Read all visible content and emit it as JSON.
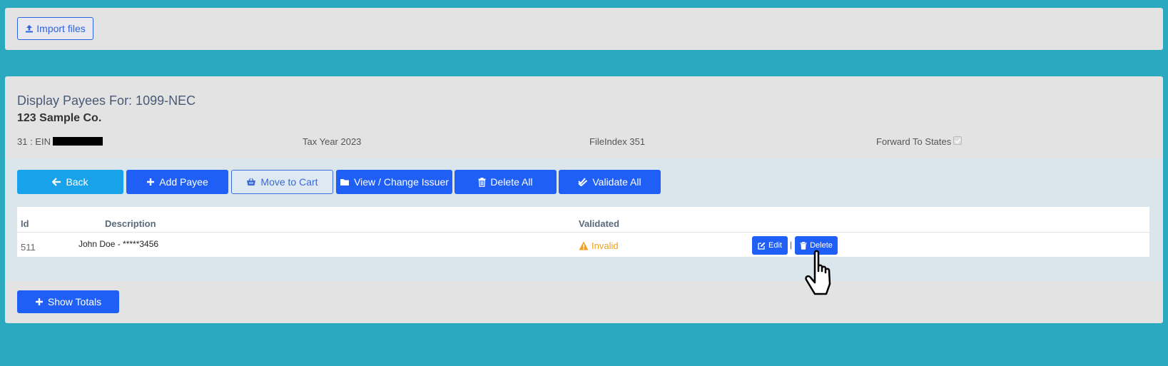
{
  "top": {
    "import_label": "Import files"
  },
  "header": {
    "title": "Display Payees For: 1099-NEC",
    "company": "123 Sample Co.",
    "ein_label": "31 : EIN",
    "tax_year": "Tax Year 2023",
    "file_index": "FileIndex 351",
    "forward_label": "Forward To States"
  },
  "toolbar": {
    "back": "Back",
    "add_payee": "Add Payee",
    "move_to_cart": "Move to Cart",
    "view_change_issuer": "View / Change Issuer",
    "delete_all": "Delete All",
    "validate_all": "Validate All"
  },
  "table": {
    "columns": {
      "id": "Id",
      "description": "Description",
      "validated": "Validated"
    },
    "rows": [
      {
        "id": "511",
        "description": "John Doe - *****3456",
        "status": "Invalid",
        "edit": "Edit",
        "delete": "Delete",
        "divider": "|"
      }
    ]
  },
  "footer": {
    "show_totals": "Show Totals"
  },
  "colors": {
    "accent": "#1f5ff5",
    "back": "#18a2e9",
    "warning": "#f0a020",
    "background": "#2aa9bf"
  }
}
